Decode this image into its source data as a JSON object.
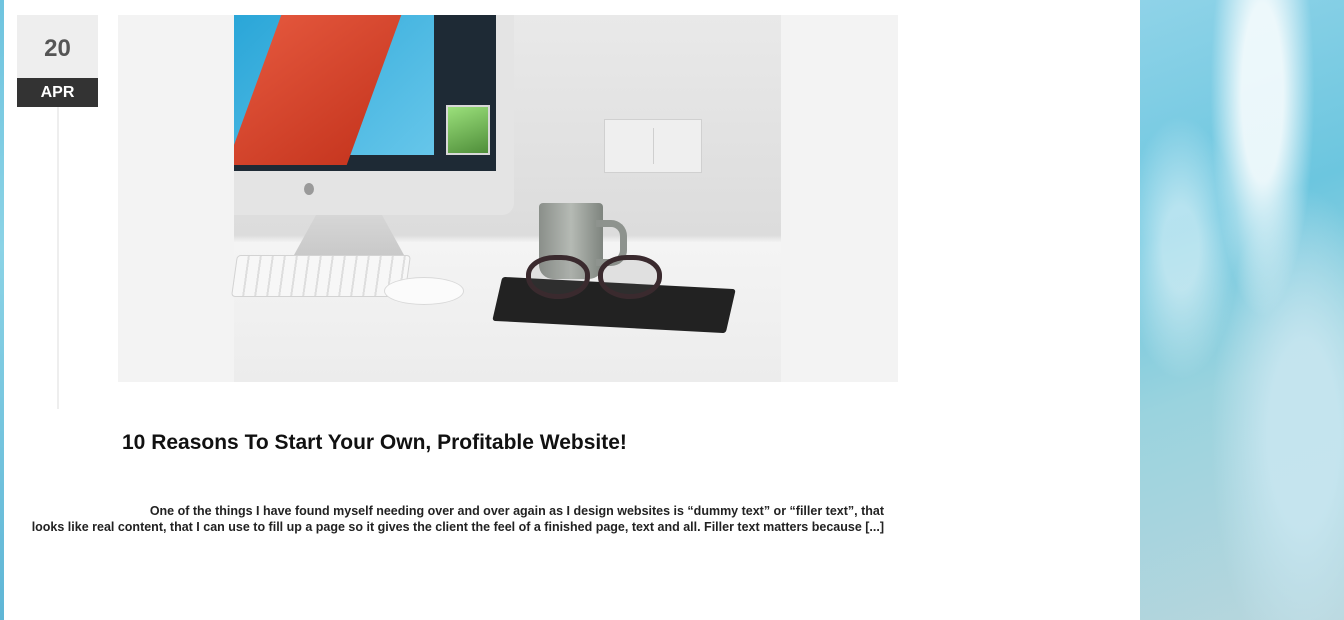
{
  "post": {
    "date": {
      "day": "20",
      "month": "APR"
    },
    "title": "10 Reasons To Start Your Own, Profitable Website!",
    "excerpt_line1": "One of the things I have found myself needing over and over again as I design websites is “dummy text” or “filler text”, that",
    "excerpt_line2": "looks like real content, that I can use to fill up a page so it gives the client the feel of a finished page, text and all. Filler text matters because",
    "read_more": "[...]"
  },
  "colors": {
    "date_day_bg": "#eeeeee",
    "date_month_bg": "#333333",
    "title_text": "#111111",
    "accent_background": "#7fcfe4"
  }
}
